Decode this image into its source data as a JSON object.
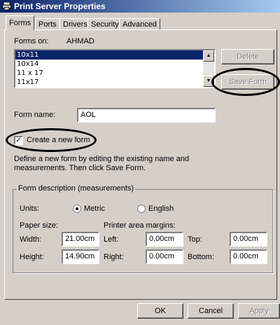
{
  "window": {
    "title": "Print Server Properties"
  },
  "tabs": [
    {
      "label": "Forms",
      "active": true
    },
    {
      "label": "Ports",
      "active": false
    },
    {
      "label": "Drivers",
      "active": false
    },
    {
      "label": "Security",
      "active": false
    },
    {
      "label": "Advanced",
      "active": false
    }
  ],
  "forms_on": {
    "label": "Forms on:",
    "server": "AHMAD"
  },
  "forms_list": {
    "items": [
      "10x11",
      "10x14",
      "11 x 17",
      "11x17"
    ],
    "selected_index": 0
  },
  "buttons": {
    "delete": "Delete",
    "save_form": "Save Form",
    "ok": "OK",
    "cancel": "Cancel",
    "apply": "Apply"
  },
  "form_name": {
    "label": "Form name:",
    "value": "AOL"
  },
  "create_new": {
    "label": "Create a new form",
    "checked": true
  },
  "help_text": {
    "line1": "Define a new form by editing the existing name and",
    "line2": "measurements. Then click Save Form."
  },
  "description": {
    "legend": "Form description (measurements)",
    "units_label": "Units:",
    "metric_label": "Metric",
    "english_label": "English",
    "units_selected": "Metric",
    "paper_size_label": "Paper size:",
    "margins_label": "Printer area margins:",
    "width_label": "Width:",
    "width_value": "21.00cm",
    "height_label": "Height:",
    "height_value": "14.90cm",
    "left_label": "Left:",
    "left_value": "0.00cm",
    "right_label": "Right:",
    "right_value": "0.00cm",
    "top_label": "Top:",
    "top_value": "0.00cm",
    "bottom_label": "Bottom:",
    "bottom_value": "0.00cm"
  },
  "colors": {
    "title_start": "#0a246a",
    "title_end": "#a6caf0",
    "face": "#d4d0c8",
    "selection": "#0a246a"
  }
}
